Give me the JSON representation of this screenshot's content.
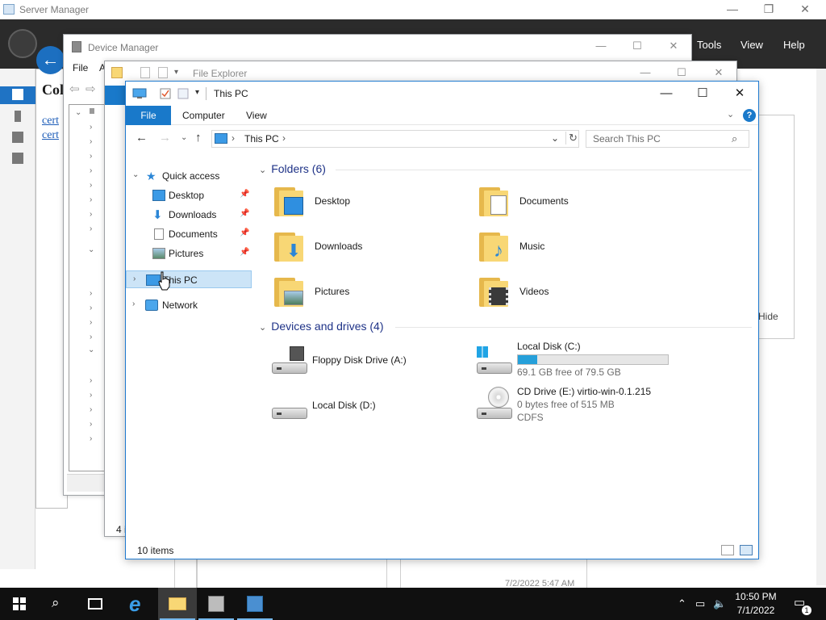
{
  "server_manager": {
    "title": "Server Manager",
    "menu": {
      "tools": "Tools",
      "view": "View",
      "help": "Help"
    },
    "hide_label": "Hide",
    "bottom_time": "7/2/2022 5:47 AM"
  },
  "cert_dialog": {
    "heading": "Col",
    "links": [
      "cert",
      "cert"
    ]
  },
  "device_manager": {
    "title": "Device Manager",
    "menu": {
      "file": "File",
      "action": "A"
    }
  },
  "explorer_back": {
    "title": "File Explorer",
    "status_count": "4 i"
  },
  "explorer": {
    "title": "This PC",
    "ribbon": {
      "file": "File",
      "computer": "Computer",
      "view": "View",
      "help": "?"
    },
    "address": {
      "path": "This PC",
      "separator": "›"
    },
    "search": {
      "placeholder": "Search This PC"
    },
    "nav": {
      "quick_access": "Quick access",
      "items": [
        {
          "label": "Desktop",
          "icon": "desktop-icon",
          "pinned": true
        },
        {
          "label": "Downloads",
          "icon": "downloads-icon",
          "pinned": true
        },
        {
          "label": "Documents",
          "icon": "documents-icon",
          "pinned": true
        },
        {
          "label": "Pictures",
          "icon": "pictures-icon",
          "pinned": true
        }
      ],
      "this_pc": "This PC",
      "network": "Network"
    },
    "folders_header": "Folders (6)",
    "folders": [
      {
        "label": "Desktop",
        "icon": "desktop-folder-icon"
      },
      {
        "label": "Documents",
        "icon": "documents-folder-icon"
      },
      {
        "label": "Downloads",
        "icon": "downloads-folder-icon"
      },
      {
        "label": "Music",
        "icon": "music-folder-icon"
      },
      {
        "label": "Pictures",
        "icon": "pictures-folder-icon"
      },
      {
        "label": "Videos",
        "icon": "videos-folder-icon"
      }
    ],
    "drives_header": "Devices and drives (4)",
    "drives": [
      {
        "name": "Floppy Disk Drive (A:)",
        "icon": "floppy-drive-icon"
      },
      {
        "name": "Local Disk (C:)",
        "free": "69.1 GB free of 79.5 GB",
        "used_fraction": 0.131,
        "icon": "windows-drive-icon"
      },
      {
        "name": "Local Disk (D:)",
        "icon": "hard-drive-icon"
      },
      {
        "name": "CD Drive (E:) virtio-win-0.1.215",
        "free": "0 bytes free of 515 MB",
        "fs": "CDFS",
        "icon": "cd-drive-icon"
      }
    ],
    "status": {
      "count": "10 items"
    },
    "colors": {
      "accent": "#1979ca",
      "selection": "#cce4f7",
      "header_text": "#1e3287",
      "bar_fill": "#26a0da"
    }
  },
  "taskbar": {
    "time": "10:50 PM",
    "date": "7/1/2022",
    "notification_count": "1",
    "apps": [
      "start-icon",
      "search-icon",
      "task-view-icon",
      "internet-explorer-icon",
      "file-explorer-icon",
      "server-manager-icon",
      "network-manager-icon"
    ]
  }
}
